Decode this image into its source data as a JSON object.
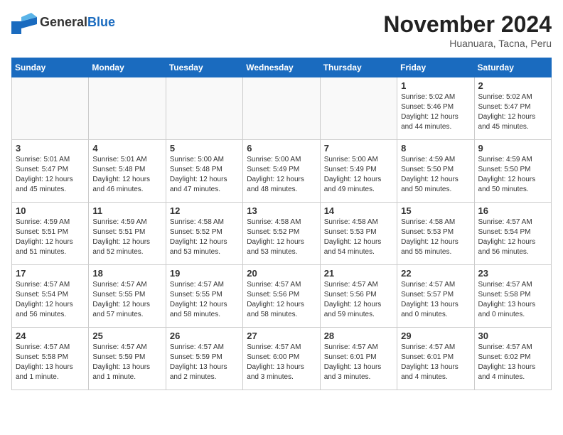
{
  "header": {
    "logo_general": "General",
    "logo_blue": "Blue",
    "title": "November 2024",
    "location": "Huanuara, Tacna, Peru"
  },
  "days_of_week": [
    "Sunday",
    "Monday",
    "Tuesday",
    "Wednesday",
    "Thursday",
    "Friday",
    "Saturday"
  ],
  "weeks": [
    [
      {
        "day": "",
        "info": ""
      },
      {
        "day": "",
        "info": ""
      },
      {
        "day": "",
        "info": ""
      },
      {
        "day": "",
        "info": ""
      },
      {
        "day": "",
        "info": ""
      },
      {
        "day": "1",
        "info": "Sunrise: 5:02 AM\nSunset: 5:46 PM\nDaylight: 12 hours\nand 44 minutes."
      },
      {
        "day": "2",
        "info": "Sunrise: 5:02 AM\nSunset: 5:47 PM\nDaylight: 12 hours\nand 45 minutes."
      }
    ],
    [
      {
        "day": "3",
        "info": "Sunrise: 5:01 AM\nSunset: 5:47 PM\nDaylight: 12 hours\nand 45 minutes."
      },
      {
        "day": "4",
        "info": "Sunrise: 5:01 AM\nSunset: 5:48 PM\nDaylight: 12 hours\nand 46 minutes."
      },
      {
        "day": "5",
        "info": "Sunrise: 5:00 AM\nSunset: 5:48 PM\nDaylight: 12 hours\nand 47 minutes."
      },
      {
        "day": "6",
        "info": "Sunrise: 5:00 AM\nSunset: 5:49 PM\nDaylight: 12 hours\nand 48 minutes."
      },
      {
        "day": "7",
        "info": "Sunrise: 5:00 AM\nSunset: 5:49 PM\nDaylight: 12 hours\nand 49 minutes."
      },
      {
        "day": "8",
        "info": "Sunrise: 4:59 AM\nSunset: 5:50 PM\nDaylight: 12 hours\nand 50 minutes."
      },
      {
        "day": "9",
        "info": "Sunrise: 4:59 AM\nSunset: 5:50 PM\nDaylight: 12 hours\nand 50 minutes."
      }
    ],
    [
      {
        "day": "10",
        "info": "Sunrise: 4:59 AM\nSunset: 5:51 PM\nDaylight: 12 hours\nand 51 minutes."
      },
      {
        "day": "11",
        "info": "Sunrise: 4:59 AM\nSunset: 5:51 PM\nDaylight: 12 hours\nand 52 minutes."
      },
      {
        "day": "12",
        "info": "Sunrise: 4:58 AM\nSunset: 5:52 PM\nDaylight: 12 hours\nand 53 minutes."
      },
      {
        "day": "13",
        "info": "Sunrise: 4:58 AM\nSunset: 5:52 PM\nDaylight: 12 hours\nand 53 minutes."
      },
      {
        "day": "14",
        "info": "Sunrise: 4:58 AM\nSunset: 5:53 PM\nDaylight: 12 hours\nand 54 minutes."
      },
      {
        "day": "15",
        "info": "Sunrise: 4:58 AM\nSunset: 5:53 PM\nDaylight: 12 hours\nand 55 minutes."
      },
      {
        "day": "16",
        "info": "Sunrise: 4:57 AM\nSunset: 5:54 PM\nDaylight: 12 hours\nand 56 minutes."
      }
    ],
    [
      {
        "day": "17",
        "info": "Sunrise: 4:57 AM\nSunset: 5:54 PM\nDaylight: 12 hours\nand 56 minutes."
      },
      {
        "day": "18",
        "info": "Sunrise: 4:57 AM\nSunset: 5:55 PM\nDaylight: 12 hours\nand 57 minutes."
      },
      {
        "day": "19",
        "info": "Sunrise: 4:57 AM\nSunset: 5:55 PM\nDaylight: 12 hours\nand 58 minutes."
      },
      {
        "day": "20",
        "info": "Sunrise: 4:57 AM\nSunset: 5:56 PM\nDaylight: 12 hours\nand 58 minutes."
      },
      {
        "day": "21",
        "info": "Sunrise: 4:57 AM\nSunset: 5:56 PM\nDaylight: 12 hours\nand 59 minutes."
      },
      {
        "day": "22",
        "info": "Sunrise: 4:57 AM\nSunset: 5:57 PM\nDaylight: 13 hours\nand 0 minutes."
      },
      {
        "day": "23",
        "info": "Sunrise: 4:57 AM\nSunset: 5:58 PM\nDaylight: 13 hours\nand 0 minutes."
      }
    ],
    [
      {
        "day": "24",
        "info": "Sunrise: 4:57 AM\nSunset: 5:58 PM\nDaylight: 13 hours\nand 1 minute."
      },
      {
        "day": "25",
        "info": "Sunrise: 4:57 AM\nSunset: 5:59 PM\nDaylight: 13 hours\nand 1 minute."
      },
      {
        "day": "26",
        "info": "Sunrise: 4:57 AM\nSunset: 5:59 PM\nDaylight: 13 hours\nand 2 minutes."
      },
      {
        "day": "27",
        "info": "Sunrise: 4:57 AM\nSunset: 6:00 PM\nDaylight: 13 hours\nand 3 minutes."
      },
      {
        "day": "28",
        "info": "Sunrise: 4:57 AM\nSunset: 6:01 PM\nDaylight: 13 hours\nand 3 minutes."
      },
      {
        "day": "29",
        "info": "Sunrise: 4:57 AM\nSunset: 6:01 PM\nDaylight: 13 hours\nand 4 minutes."
      },
      {
        "day": "30",
        "info": "Sunrise: 4:57 AM\nSunset: 6:02 PM\nDaylight: 13 hours\nand 4 minutes."
      }
    ]
  ]
}
